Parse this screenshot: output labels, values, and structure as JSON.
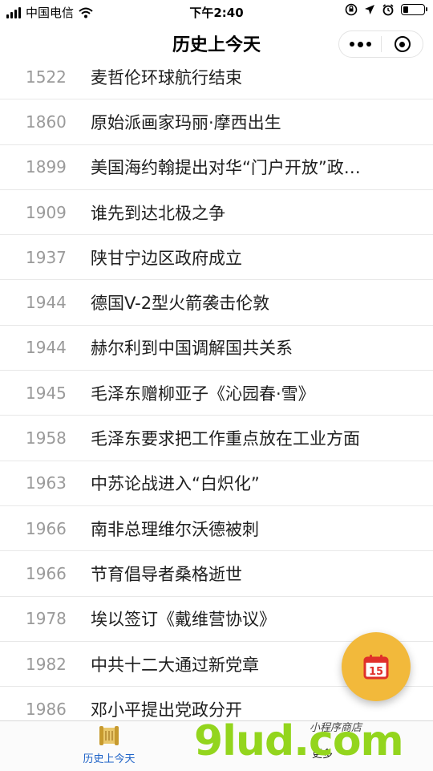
{
  "status_bar": {
    "carrier": "中国电信",
    "time": "下午2:40"
  },
  "nav": {
    "title": "历史上今天"
  },
  "events": [
    {
      "year": "1522",
      "title": "麦哲伦环球航行结束"
    },
    {
      "year": "1860",
      "title": "原始派画家玛丽·摩西出生"
    },
    {
      "year": "1899",
      "title": "美国海约翰提出对华“门户开放”政…"
    },
    {
      "year": "1909",
      "title": "谁先到达北极之争"
    },
    {
      "year": "1937",
      "title": "陕甘宁边区政府成立"
    },
    {
      "year": "1944",
      "title": "德国V-2型火箭袭击伦敦"
    },
    {
      "year": "1944",
      "title": "赫尔利到中国调解国共关系"
    },
    {
      "year": "1945",
      "title": "毛泽东赠柳亚子《沁园春·雪》"
    },
    {
      "year": "1958",
      "title": "毛泽东要求把工作重点放在工业方面"
    },
    {
      "year": "1963",
      "title": "中苏论战进入“白炽化”"
    },
    {
      "year": "1966",
      "title": "南非总理维尔沃德被刺"
    },
    {
      "year": "1966",
      "title": "节育倡导者桑格逝世"
    },
    {
      "year": "1978",
      "title": "埃以签订《戴维营协议》"
    },
    {
      "year": "1982",
      "title": "中共十二大通过新党章"
    },
    {
      "year": "1986",
      "title": "邓小平提出党政分开"
    }
  ],
  "fab": {
    "date_number": "15",
    "icon": "calendar-icon"
  },
  "tab_bar": {
    "history_label": "历史上今天",
    "more_label": "更多"
  },
  "watermark": {
    "main": "9lud.com",
    "small": "小程序商店"
  },
  "colors": {
    "accent": "#1d62c7",
    "fab": "#f2b93b",
    "watermark": "#93d51d"
  }
}
